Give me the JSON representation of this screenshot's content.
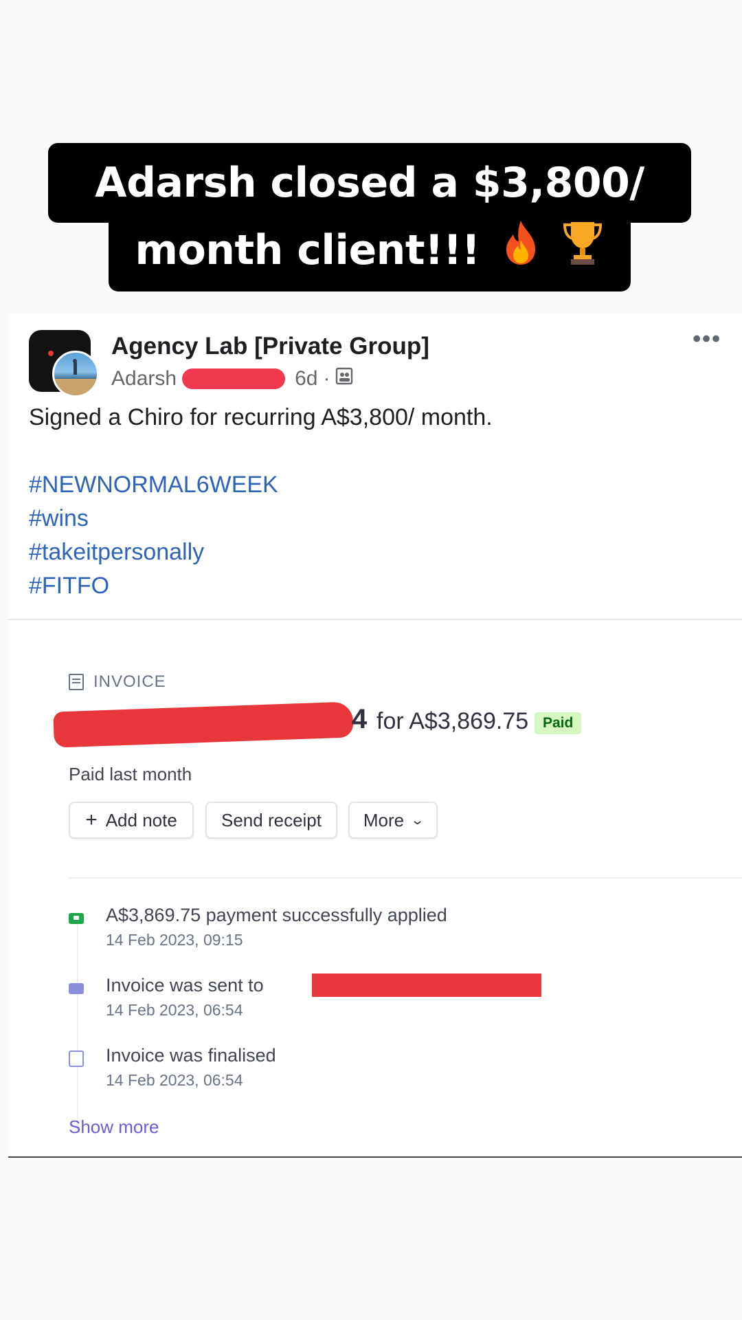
{
  "banner": {
    "line1": "Adarsh closed a $3,800/",
    "line2": "month client!!!",
    "emojis": [
      "fire",
      "trophy"
    ]
  },
  "post": {
    "group_name": "Agency Lab [Private Group]",
    "author": "Adarsh",
    "time": "6d",
    "separator": "·",
    "text": "Signed a Chiro for recurring A$3,800/ month.",
    "hashtags": [
      "#NEWNORMAL6WEEK",
      "#wins",
      "#takeitpersonally",
      "#FITFO"
    ],
    "more_icon": "more-horizontal-icon"
  },
  "invoice": {
    "label": "INVOICE",
    "number_suffix": "4",
    "amount_text": "for A$3,869.75",
    "status_badge": "Paid",
    "paid_when": "Paid last month",
    "buttons": {
      "add_note": "Add note",
      "send_receipt": "Send receipt",
      "more": "More"
    },
    "events": [
      {
        "title": "A$3,869.75 payment successfully applied",
        "time": "14 Feb 2023, 09:15",
        "icon": "payment-icon"
      },
      {
        "title": "Invoice was sent to",
        "time": "14 Feb 2023, 06:54",
        "icon": "mail-icon"
      },
      {
        "title": "Invoice was finalised",
        "time": "14 Feb 2023, 06:54",
        "icon": "document-icon"
      }
    ],
    "show_more": "Show more"
  },
  "colors": {
    "hashtag": "#2d63b8",
    "redaction": "#e8373a",
    "paid_badge_bg": "#d7f7c2",
    "show_more": "#6b5bd6"
  }
}
